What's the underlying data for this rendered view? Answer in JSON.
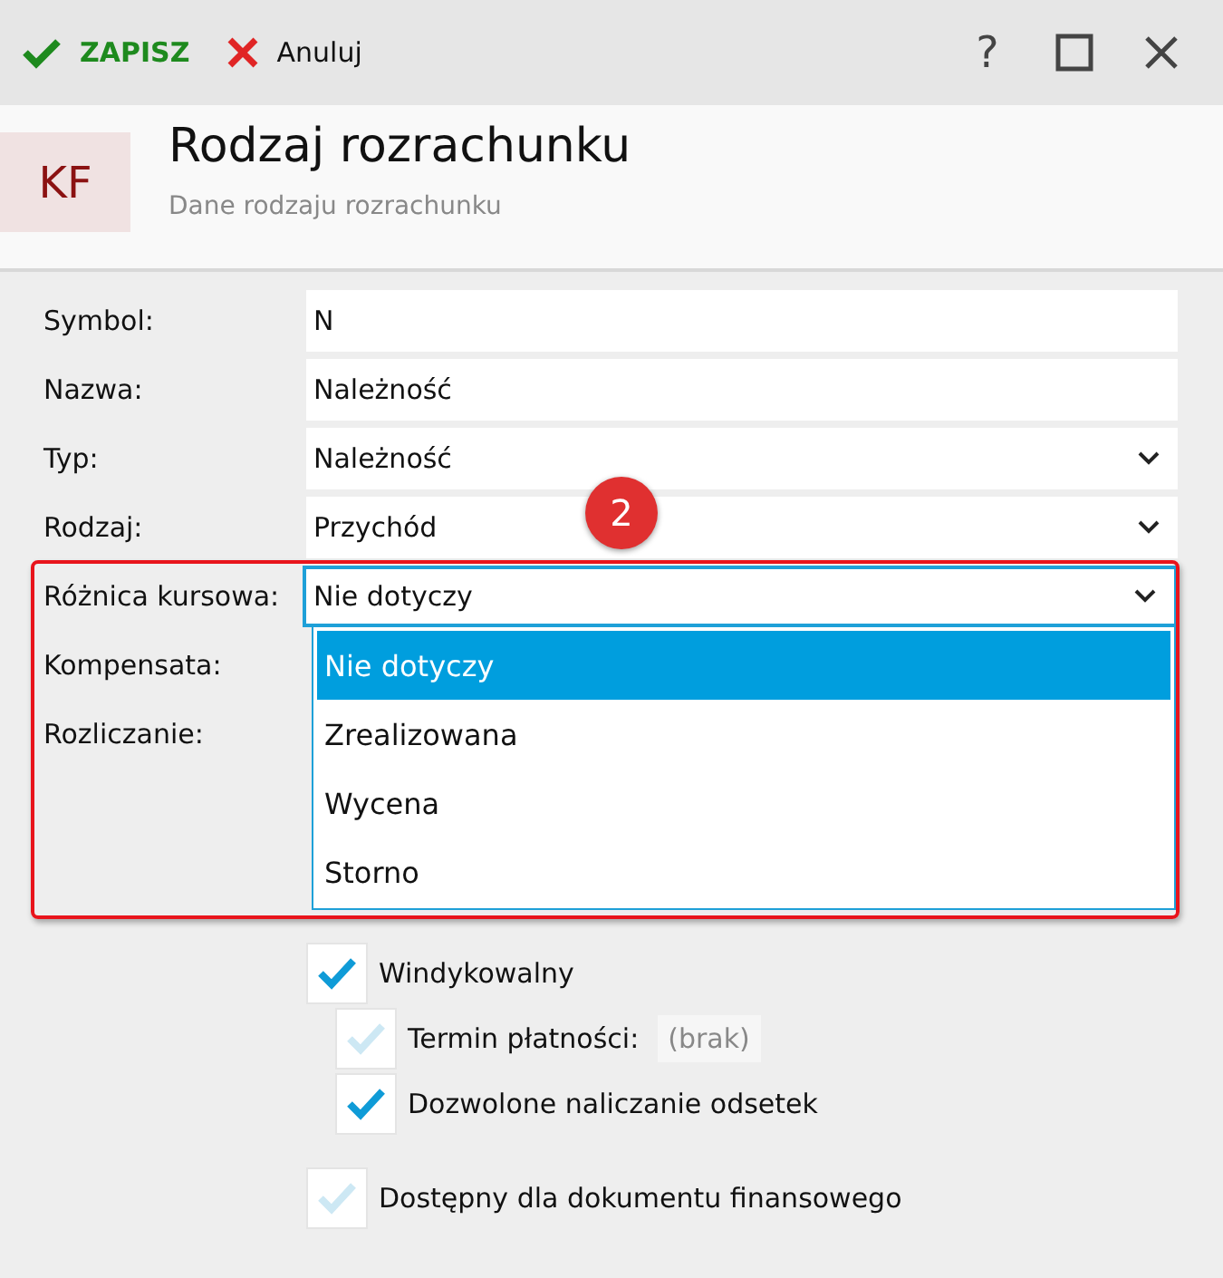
{
  "toolbar": {
    "save": "ZAPISZ",
    "cancel": "Anuluj",
    "help": "?"
  },
  "header": {
    "badge": "KF",
    "title": "Rodzaj rozrachunku",
    "subtitle": "Dane rodzaju rozrachunku"
  },
  "fields": [
    {
      "label": "Symbol:",
      "kind": "text",
      "value": "N"
    },
    {
      "label": "Nazwa:",
      "kind": "text",
      "value": "Należność"
    },
    {
      "label": "Typ:",
      "kind": "select",
      "value": "Należność"
    },
    {
      "label": "Rodzaj:",
      "kind": "select",
      "value": "Przychód"
    },
    {
      "label": "Różnica kursowa:",
      "kind": "select",
      "value": "Nie dotyczy",
      "focused": true
    },
    {
      "label": "Kompensata:",
      "kind": "hidden"
    },
    {
      "label": "Rozliczanie:",
      "kind": "hidden"
    }
  ],
  "dropdown": {
    "options": [
      {
        "label": "Nie dotyczy",
        "selected": true
      },
      {
        "label": "Zrealizowana",
        "selected": false
      },
      {
        "label": "Wycena",
        "selected": false
      },
      {
        "label": "Storno",
        "selected": false
      }
    ]
  },
  "callout": "2",
  "checkboxes": [
    {
      "label": "Windykowalny",
      "checked": true,
      "children": [
        {
          "label": "Termin płatności:",
          "checked": false,
          "placeholder": "(brak)"
        },
        {
          "label": "Dozwolone naliczanie odsetek",
          "checked": true
        }
      ]
    },
    {
      "label": "Dostępny dla dokumentu finansowego",
      "checked": false
    }
  ]
}
